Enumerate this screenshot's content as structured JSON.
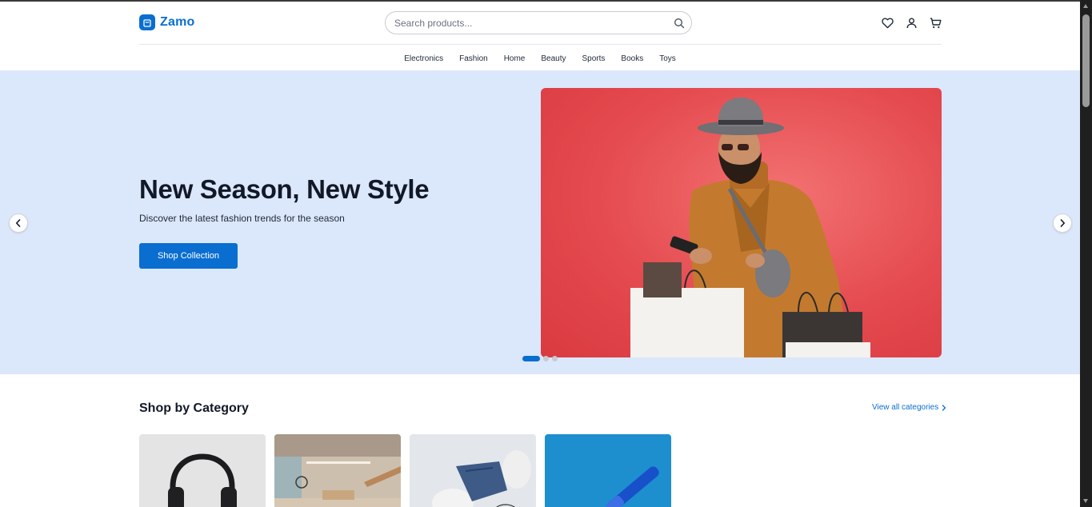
{
  "header": {
    "brand": "Zamo",
    "search_placeholder": "Search products..."
  },
  "nav": {
    "items": [
      "Electronics",
      "Fashion",
      "Home",
      "Beauty",
      "Sports",
      "Books",
      "Toys"
    ]
  },
  "hero": {
    "title": "New Season, New Style",
    "subtitle": "Discover the latest fashion trends for the season",
    "cta_label": "Shop Collection",
    "active_slide": 1,
    "slide_count": 3
  },
  "categories": {
    "title": "Shop by Category",
    "view_all_label": "View all categories"
  },
  "colors": {
    "accent": "#0a6ed1",
    "hero_bg": "#dbe7fb",
    "hero_image_bg": "#e44a4f"
  },
  "icons": {
    "search": "search-icon",
    "wishlist": "heart-icon",
    "account": "user-icon",
    "cart": "cart-icon",
    "prev": "chevron-left-icon",
    "next": "chevron-right-icon"
  }
}
